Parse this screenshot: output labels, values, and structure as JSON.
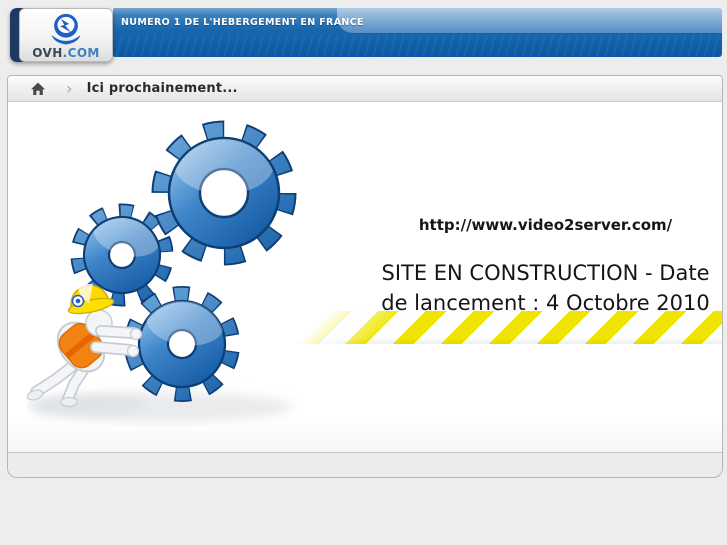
{
  "header": {
    "logo": {
      "brand": "OVH",
      "brand_suffix": ".COM"
    },
    "banner": {
      "slogan": "NUMERO 1 DE L'HEBERGEMENT EN FRANCE"
    }
  },
  "breadcrumb": {
    "home_icon": "home-icon",
    "separator_glyph": "›",
    "label": "Ici prochainement..."
  },
  "content": {
    "site_url": "http://www.video2server.com/",
    "construction_lines": [
      "SITE EN CONSTRUCTION - Date",
      "de lancement : 4 Octobre 2010"
    ],
    "illustration": "worker-pushing-blue-gears"
  },
  "colors": {
    "page_background": "#ededed",
    "banner_blue_top": "#7aa6cf",
    "banner_blue_bottom": "#0b59a3",
    "logo_navy": "#1d3a63",
    "logo_blue": "#1f5fc8",
    "gear_blue": "#2f7cc3",
    "hazard_yellow": "#f0e500",
    "vest_orange": "#f28211",
    "helmet_yellow": "#ffd900"
  }
}
